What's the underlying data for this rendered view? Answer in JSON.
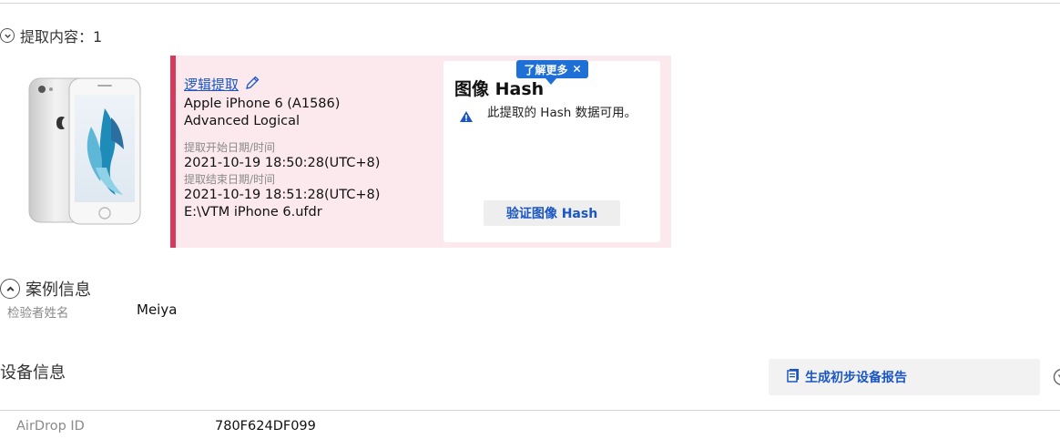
{
  "extraction": {
    "header_label": "提取内容：1",
    "link_label": "逻辑提取",
    "device_model": "Apple iPhone 6 (A1586)",
    "extraction_type": "Advanced Logical",
    "start_label": "提取开始日期/时间",
    "start_value": "2021-10-19 18:50:28(UTC+8)",
    "end_label": "提取结束日期/时间",
    "end_value": "2021-10-19 18:51:28(UTC+8)",
    "file_path": "E:\\VTM iPhone 6.ufdr"
  },
  "hash_panel": {
    "title": "图像 Hash",
    "message": "此提取的 Hash 数据可用。",
    "verify_button": "验证图像 Hash",
    "learn_more_badge": "了解更多"
  },
  "case_info": {
    "header": "案例信息",
    "examiner_label": "检验者姓名",
    "examiner_value": "Meiya"
  },
  "device_info": {
    "header": "设备信息",
    "report_button": "生成初步设备报告",
    "airdrop_label": "AirDrop ID",
    "airdrop_value": "780F624DF099"
  },
  "icons": {
    "expand": "chevron-down-circle-icon",
    "collapse": "chevron-up-circle-icon",
    "edit": "pencil-icon",
    "warning": "warning-triangle-icon",
    "close": "close-icon",
    "report": "report-document-icon"
  },
  "colors": {
    "accent_red": "#d63a5d",
    "card_bg": "#fbe9ed",
    "link_blue": "#1a56c4",
    "badge_blue": "#1e6fd6"
  }
}
